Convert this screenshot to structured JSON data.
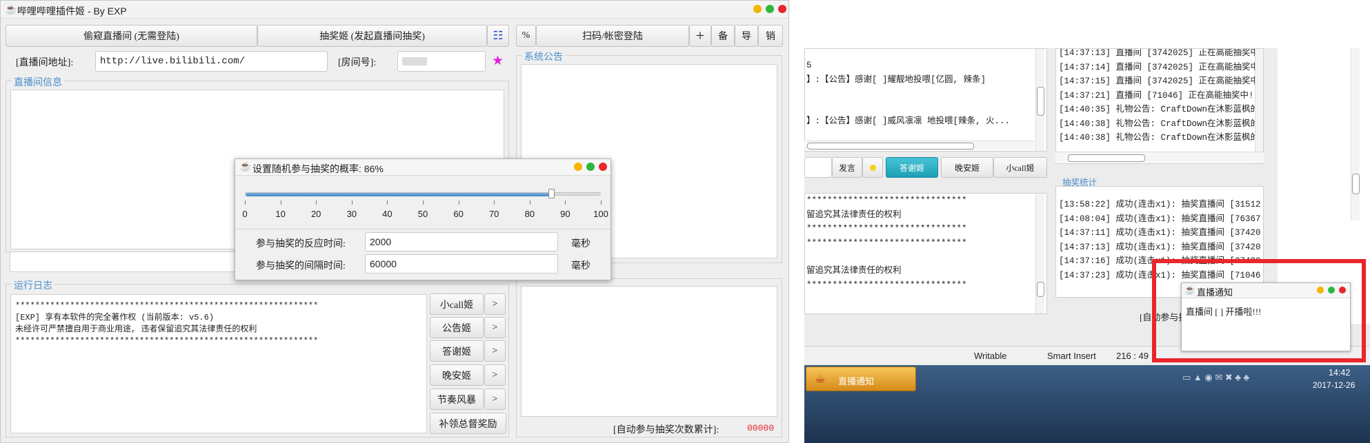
{
  "main": {
    "title": "哔哩哔哩插件姬 - By EXP",
    "tabs": [
      "偷窥直播间 (无需登陆)",
      "抽奖姬 (发起直播间抽奖)"
    ],
    "right_buttons": {
      "percent": "%",
      "login": "扫码/帐密登陆",
      "plus": "+",
      "backup": "备",
      "export": "导",
      "logout": "销"
    },
    "room_url_label": "[直播间地址]:",
    "room_url_value": "http://live.bilibili.com/",
    "room_id_label": "[房间号]:",
    "room_id_value": "",
    "star": "★",
    "live_info_legend": "直播间信息",
    "notice_legend": "系统公告",
    "runlog_legend": "运行日志",
    "runlog_lines": [
      "*************************************************************",
      " [EXP] 享有本软件的完全著作权 (当前版本: v5.6)",
      " 未经许可严禁擅自用于商业用途, 违者保留追究其法律责任的权利",
      "*************************************************************"
    ],
    "side_buttons": [
      "小call姬",
      "公告姬",
      "答谢姬",
      "晚安姬",
      "节奏风暴",
      "补领总督奖励"
    ],
    "side_arrow": ">",
    "counter_label": "[自动参与抽奖次数累计]:",
    "counter_value": "00000"
  },
  "dialog": {
    "title": "设置随机参与抽奖的概率: 86%",
    "slider_value": 86,
    "ticks": [
      "0",
      "10",
      "20",
      "30",
      "40",
      "50",
      "60",
      "70",
      "80",
      "90",
      "100"
    ],
    "reaction_label": "参与抽奖的反应时间:",
    "reaction_value": "2000",
    "interval_label": "参与抽奖的间隔时间:",
    "interval_value": "60000",
    "unit": "毫秒"
  },
  "screenshot": {
    "left_lines": [
      "5",
      "】:【公告】感谢[        ]耀靓地投喂[亿圆, 辣条]",
      "",
      "",
      "】:【公告】感谢[        ]威风凛凛 地投喂[辣条, 火..."
    ],
    "input_buttons": [
      "发言",
      "答谢姬",
      "晚安姬",
      "小call姬"
    ],
    "left_lines2": [
      "*******************************",
      "留追究其法律责任的权利",
      "*******************************",
      "*******************************",
      "",
      "留追究其法律责任的权利",
      "*******************************"
    ],
    "right_log": [
      "[14:37:13] 直播间 [3742025] 正在高能抽奖中",
      "[14:37:14] 直播间 [3742025] 正在高能抽奖中",
      "[14:37:15] 直播间 [3742025] 正在高能抽奖中",
      "[14:37:21] 直播间 [71046] 正在高能抽奖中!!",
      "[14:40:35] 礼物公告: CraftDown在沐影蓝枫的",
      "[14:40:38] 礼物公告: CraftDown在沐影蓝枫的",
      "[14:40:38] 礼物公告: CraftDown在沐影蓝枫的"
    ],
    "lottery_legend": "抽奖统计",
    "lottery_log": [
      "[13:58:22] 成功(连击x1): 抽奖直播间 [31512",
      "[14:08:04] 成功(连击x1): 抽奖直播间 [76367",
      "[14:37:11] 成功(连击x1): 抽奖直播间 [37420",
      "[14:37:13] 成功(连击x1): 抽奖直播间 [37420",
      "[14:37:16] 成功(连击x1): 抽奖直播间 [37420",
      "[14:37:23] 成功(连击x1): 抽奖直播间 [71046"
    ],
    "auto_label": "[自动参与抽",
    "notify_title": "直播通知",
    "notify_text": "直播间 [     ] 开播啦!!!",
    "status": {
      "writable": "Writable",
      "insert": "Smart Insert",
      "pos": "216 : 49"
    },
    "taskbar_task": "直播通知",
    "clock_time": "14:42",
    "clock_date": "2017-12-26",
    "highlight_color": "#e8262b"
  }
}
